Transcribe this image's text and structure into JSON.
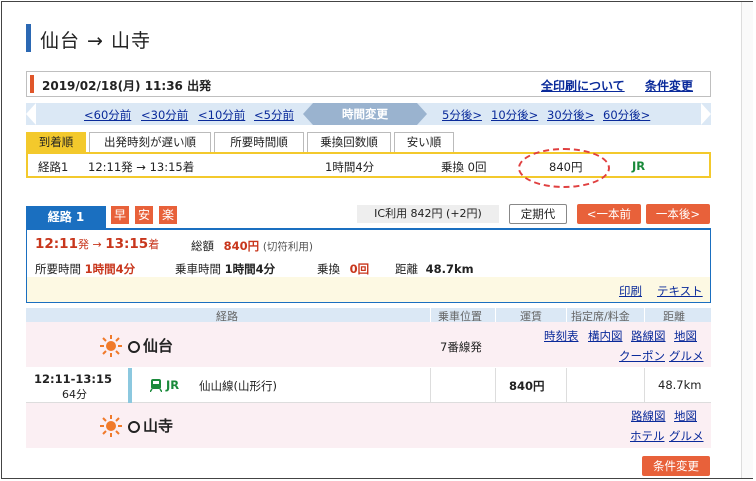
{
  "page": {
    "title": "仙台 → 山寺",
    "date_line": "2019/02/18(月) 11:36 出発",
    "print_all_link": "全印刷について",
    "change_conditions_link": "条件変更"
  },
  "time_nav": {
    "before": [
      "<60分前",
      "<30分前",
      "<10分前",
      "<5分前"
    ],
    "center": "時間変更",
    "after": [
      "5分後>",
      "10分後>",
      "30分後>",
      "60分後>"
    ]
  },
  "sort_tabs": [
    "到着順",
    "出発時刻が遅い順",
    "所要時間順",
    "乗換回数順",
    "安い順"
  ],
  "route_row": {
    "label": "経路1",
    "time": "12:11発 → 13:15着",
    "duration": "1時間4分",
    "transfers": "乗換 0回",
    "fare": "840円",
    "line": "JR"
  },
  "route_detail": {
    "tab": "経路 1",
    "badges": [
      "早",
      "安",
      "楽"
    ],
    "ic_fare": "IC利用 842円 (+2円)",
    "teiki": "定期代",
    "prev_btn": "<一本前",
    "next_btn": "一本後>",
    "depart": "12:11",
    "depart_suffix": "発 → ",
    "arrive": "13:15",
    "arrive_suffix": "着",
    "total_label": "総額",
    "total_value": "840円",
    "total_note": "(切符利用)",
    "req_time_label": "所要時間",
    "req_time_value": "1時間4分",
    "ride_time_label": "乗車時間",
    "ride_time_value": "1時間4分",
    "transfer_label": "乗換",
    "transfer_value": "0回",
    "distance_label": "距離",
    "distance_value": "48.7km",
    "print_link": "印刷",
    "text_link": "テキスト"
  },
  "table_headers": {
    "route": "経路",
    "boarding": "乗車位置",
    "fare": "運賃",
    "reserved": "指定席/料金",
    "distance": "距離"
  },
  "origin": {
    "name": "仙台",
    "platform": "7番線発",
    "links": [
      "時刻表",
      "構内図",
      "路線図",
      "地図",
      "クーポン",
      "グルメ"
    ]
  },
  "segment": {
    "time": "12:11-13:15",
    "duration": "64分",
    "company": "JR",
    "line": "仙山線(山形行)",
    "fare": "840円",
    "distance": "48.7km"
  },
  "destination": {
    "name": "山寺",
    "links": [
      "路線図",
      "地図",
      "ホテル",
      "グルメ"
    ]
  },
  "bottom_button": "条件変更",
  "colors": {
    "accent_blue": "#1a6fc0",
    "accent_orange": "#e8613a",
    "highlight_yellow": "#f3c92c",
    "station_bg": "#fbeff3",
    "jr_green": "#1a8a3a"
  }
}
